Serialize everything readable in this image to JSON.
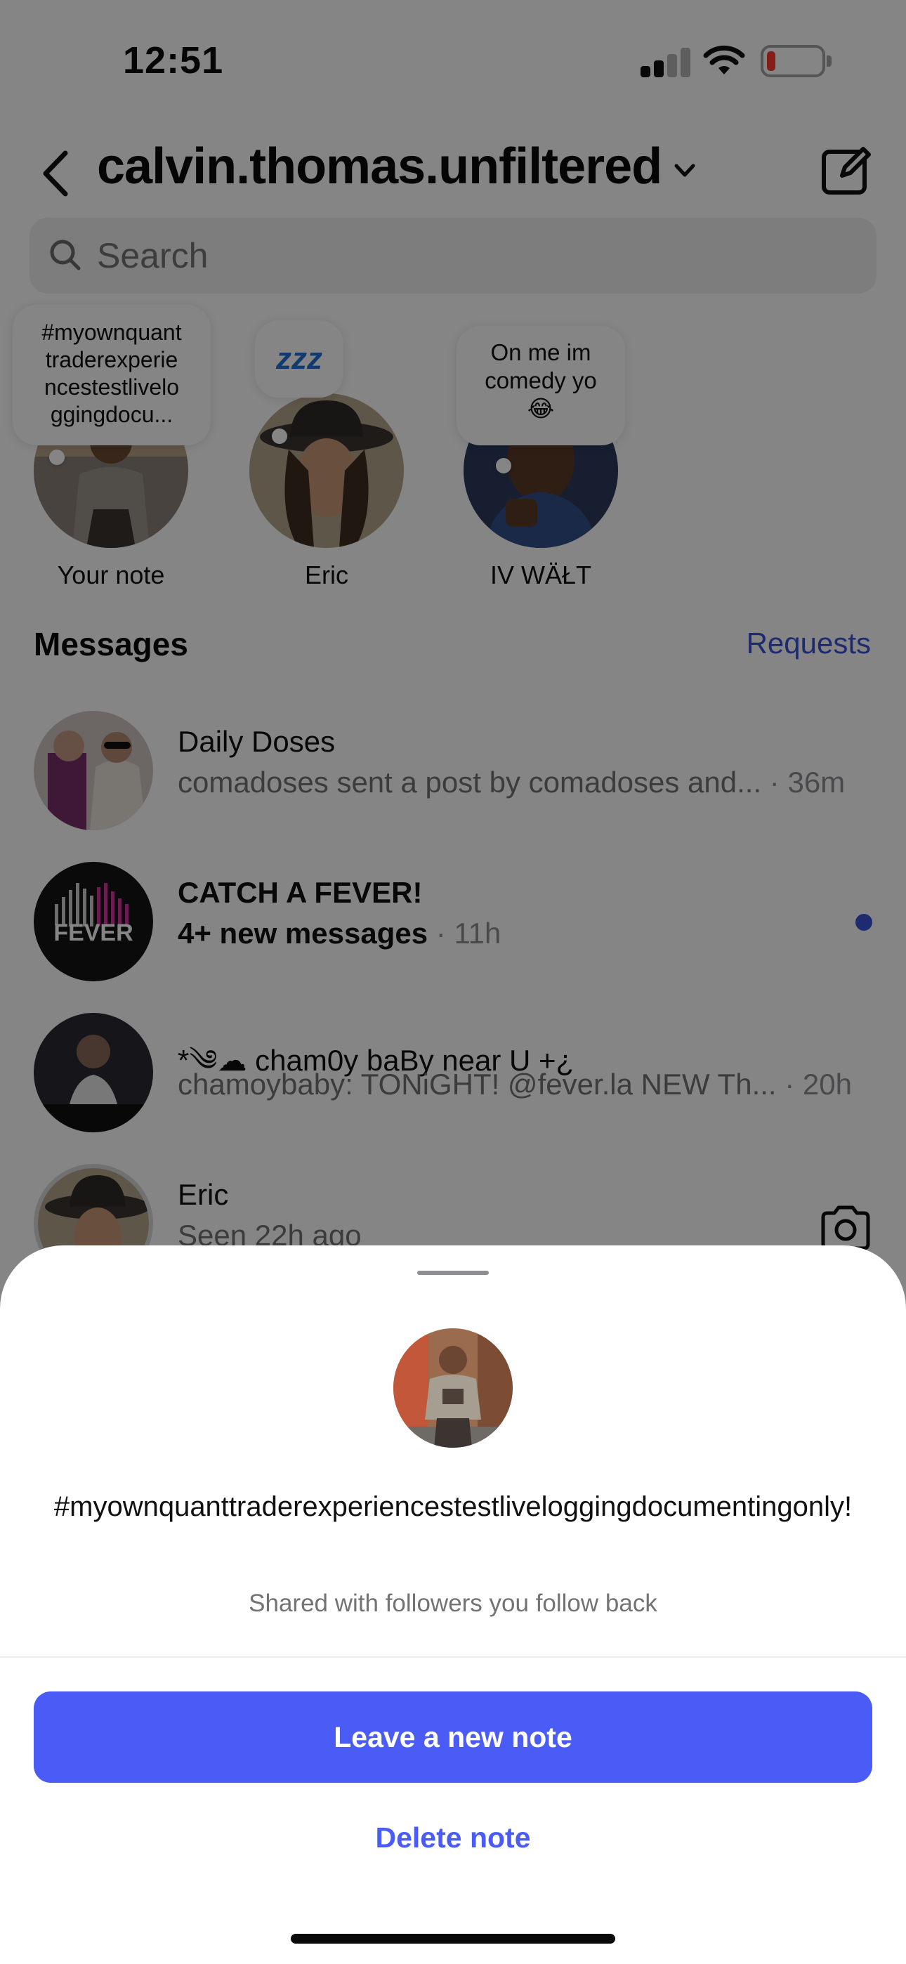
{
  "status_bar": {
    "time": "12:51",
    "battery_color": "#ff3b30"
  },
  "header": {
    "account_name": "calvin.thomas.unfiltered"
  },
  "search": {
    "placeholder": "Search"
  },
  "notes": [
    {
      "label": "Your note",
      "bubble": "#myownquanttraderexperiencestestlivelogg­ingdocu...",
      "bubble_lines": [
        "#myownquant",
        "traderexperie",
        "ncestestlivelo",
        "ggingdocu..."
      ]
    },
    {
      "label": "Eric",
      "bubble": "zzz"
    },
    {
      "label": "IV WÄŁT",
      "bubble_lines": [
        "On me im",
        "comedy yo",
        "😂"
      ]
    }
  ],
  "messages": {
    "heading": "Messages",
    "requests_label": "Requests",
    "threads": [
      {
        "name": "Daily Doses",
        "preview": "comadoses sent a post by comadoses and...",
        "time": " · 36m",
        "unread": false
      },
      {
        "name": "CATCH A FEVER!",
        "preview": "4+ new messages",
        "time": " · 11h",
        "unread": true
      },
      {
        "name": "*༄☁ cham0y baBy near U +¿",
        "preview": "chamoybaby: TONiGHT! @fever.la NEW Th...",
        "time": " · 20h",
        "unread": false
      },
      {
        "name": "Eric",
        "preview": "Seen 22h ago",
        "time": "",
        "unread": false
      }
    ]
  },
  "sheet": {
    "note_text": "#myownquanttraderexperiencestestliveloggingdocumentingonly!",
    "audience": "Shared with followers you follow back",
    "primary_button": "Leave a new note",
    "delete_button": "Delete note",
    "accent_color": "#4a5bf6"
  }
}
